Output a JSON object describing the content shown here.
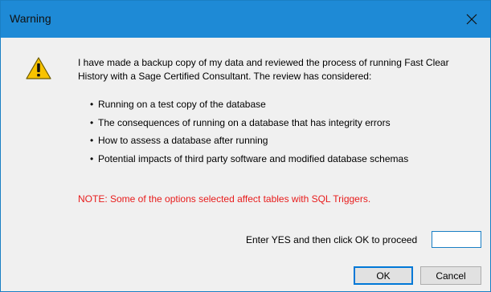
{
  "window": {
    "title": "Warning",
    "close_glyph": "×"
  },
  "dialog": {
    "icon": "warning-icon",
    "message": "I have made a backup copy of my data and reviewed the process of running Fast Clear History with a Sage Certified Consultant. The review has considered:",
    "bullets": [
      "Running on a test copy of the database",
      "The consequences of running on a database that has integrity errors",
      "How to assess a database after running",
      "Potential impacts of third party software and modified database schemas"
    ],
    "bullet_glyph": "•",
    "note": "NOTE: Some of the options selected affect tables with SQL Triggers.",
    "prompt_label": "Enter YES and then click OK to proceed",
    "prompt_value": ""
  },
  "buttons": {
    "ok": "OK",
    "cancel": "Cancel"
  },
  "colors": {
    "titlebar": "#1e8ad6",
    "note": "#e81c1c",
    "warning_fill": "#f8c300"
  }
}
